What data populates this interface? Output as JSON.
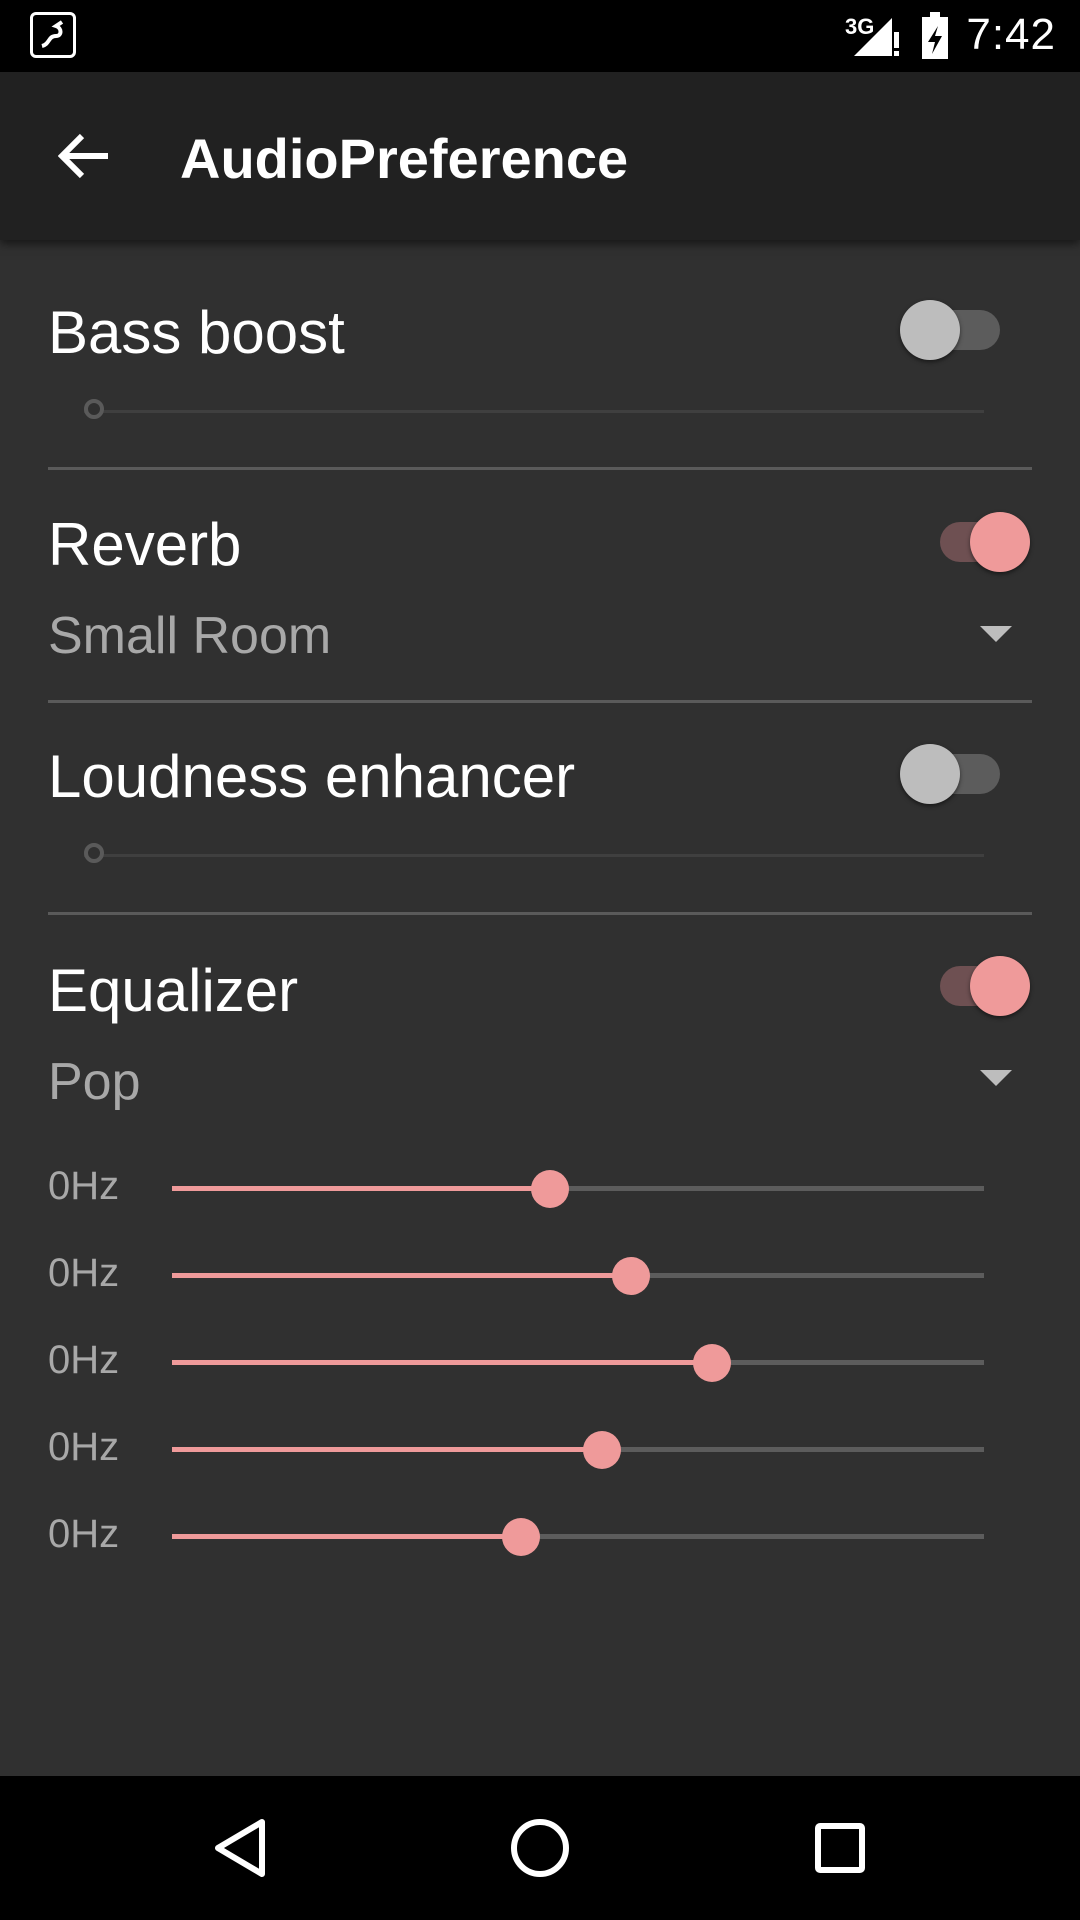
{
  "status_bar": {
    "time": "7:42",
    "network": "3G",
    "icons": [
      "app-notification-icon",
      "signal-icon",
      "battery-charging-icon"
    ]
  },
  "toolbar": {
    "title": "AudioPreference",
    "back_icon": "arrow-back-icon"
  },
  "prefs": {
    "bass_boost": {
      "label": "Bass boost",
      "enabled": false,
      "level": 0
    },
    "reverb": {
      "label": "Reverb",
      "enabled": true,
      "preset": "Small Room"
    },
    "loudness": {
      "label": "Loudness enhancer",
      "enabled": false,
      "level": 0
    },
    "equalizer": {
      "label": "Equalizer",
      "enabled": true,
      "preset": "Pop",
      "bands": [
        {
          "label": "0Hz",
          "level": 0.465
        },
        {
          "label": "0Hz",
          "level": 0.565
        },
        {
          "label": "0Hz",
          "level": 0.665
        },
        {
          "label": "0Hz",
          "level": 0.53
        },
        {
          "label": "0Hz",
          "level": 0.43
        }
      ]
    }
  },
  "colors": {
    "accent": "#ef9a9a",
    "background": "#303030",
    "toolbar": "#212121"
  },
  "nav_bar": {
    "icons": [
      "back-triangle-icon",
      "home-circle-icon",
      "recents-square-icon"
    ]
  }
}
